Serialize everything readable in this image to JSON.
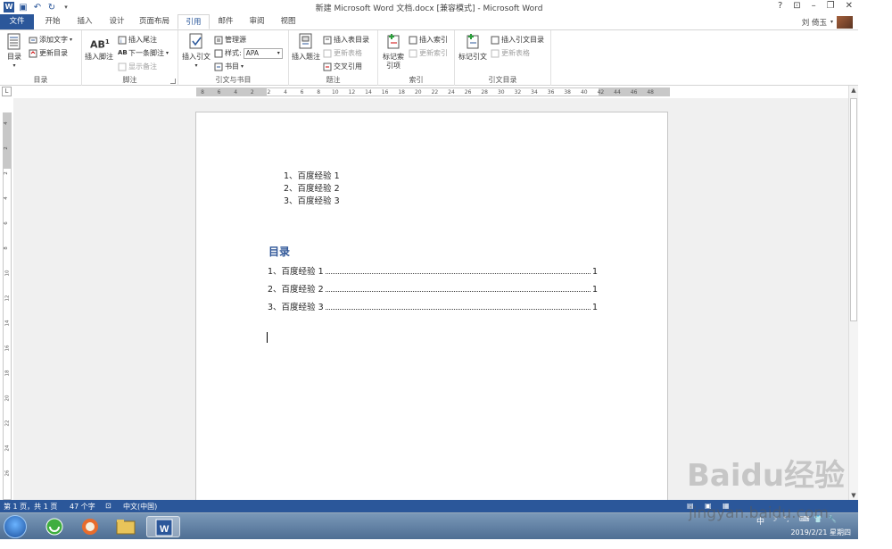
{
  "window": {
    "title": "新建 Microsoft Word 文档.docx [兼容模式] - Microsoft Word",
    "help": "?",
    "controls": [
      "⊡",
      "–",
      "❐",
      "✕"
    ]
  },
  "tabs": [
    {
      "label": "文件"
    },
    {
      "label": "开始"
    },
    {
      "label": "插入"
    },
    {
      "label": "设计"
    },
    {
      "label": "页面布局"
    },
    {
      "label": "引用"
    },
    {
      "label": "邮件"
    },
    {
      "label": "审阅"
    },
    {
      "label": "视图"
    }
  ],
  "user": {
    "name": "刘 倚玉"
  },
  "ribbon": {
    "toc": {
      "group": "目录",
      "toc_btn": "目录",
      "add_text": "添加文字",
      "update_table": "更新目录"
    },
    "footnotes": {
      "group": "脚注",
      "insert_footnote": "插入脚注",
      "insert_endnote": "插入尾注",
      "next_footnote": "下一条脚注",
      "show_notes": "显示备注"
    },
    "citations": {
      "group": "引文与书目",
      "insert_citation": "插入引文",
      "manage_sources": "管理源",
      "style_label": "样式:",
      "style_value": "APA",
      "bibliography": "书目"
    },
    "captions": {
      "group": "题注",
      "insert_caption": "插入题注",
      "insert_tof": "插入表目录",
      "update_table": "更新表格",
      "cross_ref": "交叉引用"
    },
    "index": {
      "group": "索引",
      "mark_entry": "标记索引项",
      "insert_index": "插入索引",
      "update_index": "更新索引"
    },
    "toa": {
      "group": "引文目录",
      "mark_citation": "标记引文",
      "insert_toa": "插入引文目录",
      "update_table": "更新表格"
    }
  },
  "ruler": {
    "corner": "L",
    "numbers": [
      "8",
      "6",
      "4",
      "2",
      "2",
      "4",
      "6",
      "8",
      "10",
      "12",
      "14",
      "16",
      "18",
      "20",
      "22",
      "24",
      "26",
      "28",
      "30",
      "32",
      "34",
      "36",
      "38",
      "40",
      "42",
      "44",
      "46",
      "48"
    ],
    "vnumbers": [
      "4",
      "2",
      "2",
      "4",
      "6",
      "8",
      "10",
      "12",
      "14",
      "16",
      "18",
      "20",
      "22",
      "24",
      "26"
    ]
  },
  "document": {
    "list_items": [
      "1、百度经验 1",
      "2、百度经验 2",
      "3、百度经验 3"
    ],
    "toc_heading": "目录",
    "toc_entries": [
      {
        "text": "1、百度经验 1",
        "page": "1"
      },
      {
        "text": "2、百度经验 2",
        "page": "1"
      },
      {
        "text": "3、百度经验 3",
        "page": "1"
      }
    ]
  },
  "statusbar": {
    "page": "第 1 页，共 1 页",
    "words": "47 个字",
    "language": "中文(中国)"
  },
  "taskbar": {
    "date": "2019/2/21 星期四"
  },
  "watermark": {
    "logo": "Baidu经验",
    "url": "jingyan.baidu.com"
  }
}
